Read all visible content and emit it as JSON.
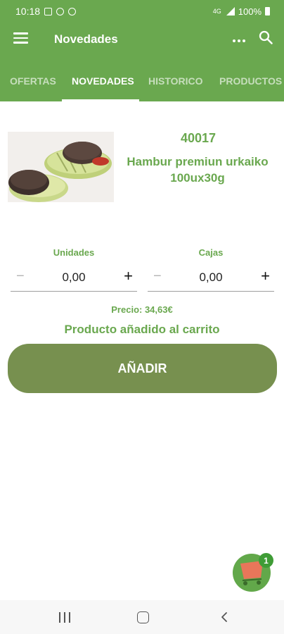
{
  "status_bar": {
    "time": "10:18",
    "battery": "100%",
    "network": "4G"
  },
  "app_bar": {
    "title": "Novedades"
  },
  "tabs": [
    {
      "label": "OFERTAS",
      "active": false
    },
    {
      "label": "NOVEDADES",
      "active": true
    },
    {
      "label": "HISTORICO",
      "active": false
    },
    {
      "label": "PRODUCTOS",
      "active": false
    }
  ],
  "product": {
    "code": "40017",
    "name": "Hambur premiun urkaiko 100ux30g",
    "image_alt": "hamburger-photo"
  },
  "units": {
    "label": "Unidades",
    "value": "0,00",
    "minus": "−",
    "plus": "+"
  },
  "boxes": {
    "label": "Cajas",
    "value": "0,00",
    "minus": "−",
    "plus": "+"
  },
  "price_text": "Precio: 34,63€",
  "added_message": "Producto añadido al carrito",
  "add_button": {
    "label": "AÑADIR"
  },
  "cart": {
    "badge_count": "1"
  },
  "colors": {
    "primary": "#6aa84f",
    "button": "#77904f",
    "badge": "#3f9c36"
  }
}
